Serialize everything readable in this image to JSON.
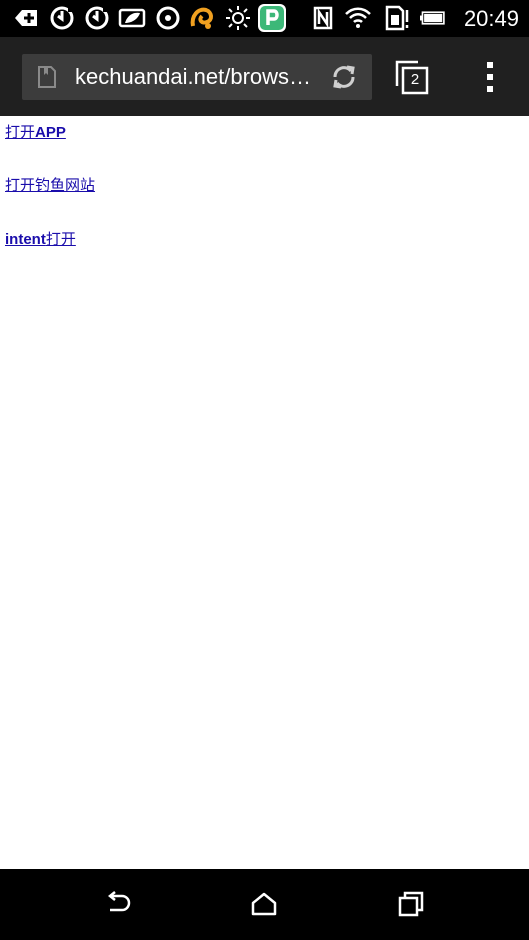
{
  "status_bar": {
    "time": "20:49",
    "icons": [
      "add-notification-icon",
      "sync-icon",
      "sync-icon",
      "leaf-icon",
      "circle-clock-icon",
      "uc-browser-icon",
      "brightness-icon",
      "parking-app-icon",
      "nfc-icon",
      "wifi-icon",
      "sim-data-icon",
      "battery-icon"
    ]
  },
  "browser": {
    "url": "kechuandai.net/browser...",
    "tab_count": "2"
  },
  "links": [
    {
      "pre": "打开",
      "bold": "APP",
      "post": ""
    },
    {
      "pre": "打开钓鱼网站",
      "bold": "",
      "post": ""
    },
    {
      "pre": "",
      "bold": "intent",
      "post": "打开"
    }
  ],
  "colors": {
    "link": "#1a0dab",
    "toolbar": "#202020",
    "omnibox": "#3c3c3c",
    "status_bar": "#000000"
  },
  "nav_bar": {
    "icons": [
      "back-icon",
      "home-icon",
      "recent-apps-icon"
    ]
  }
}
